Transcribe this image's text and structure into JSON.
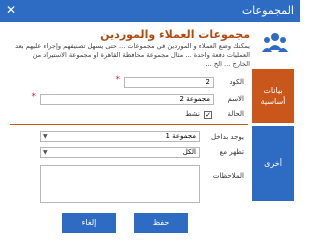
{
  "window": {
    "title": "المجموعات",
    "close_glyph": "✕"
  },
  "header": {
    "title": "مجموعات العملاء والموردين",
    "description": "يمكنك وضع العملاء و الموردين في مجموعات ... حتى يسهل تصنيفهم وإجراء عليهم بعد العمليات دفعة واحدة ... مثال مجموعة محافظة القاهرة او مجموعة الاستيراد من الخارج ... الخ ..."
  },
  "tabs": {
    "basic": "بيانات أساسية",
    "other": "أخرى"
  },
  "form": {
    "code_label": "الكود",
    "code_value": "2",
    "name_label": "الاسم",
    "name_value": "مجموعة 2",
    "status_label": "الحالة",
    "active_label": "نشط",
    "active_checked": "✓",
    "parent_label": "يوجد بداخل",
    "parent_value": "مجموعة 1",
    "show_with_label": "تظهر مع",
    "show_with_value": "الكل",
    "notes_label": "الملاحظات",
    "notes_value": ""
  },
  "buttons": {
    "save": "حفظ",
    "cancel": "إلغاء"
  },
  "colors": {
    "accent_blue": "#2e6cc4",
    "accent_orange": "#c9571c",
    "required": "#e02020"
  }
}
